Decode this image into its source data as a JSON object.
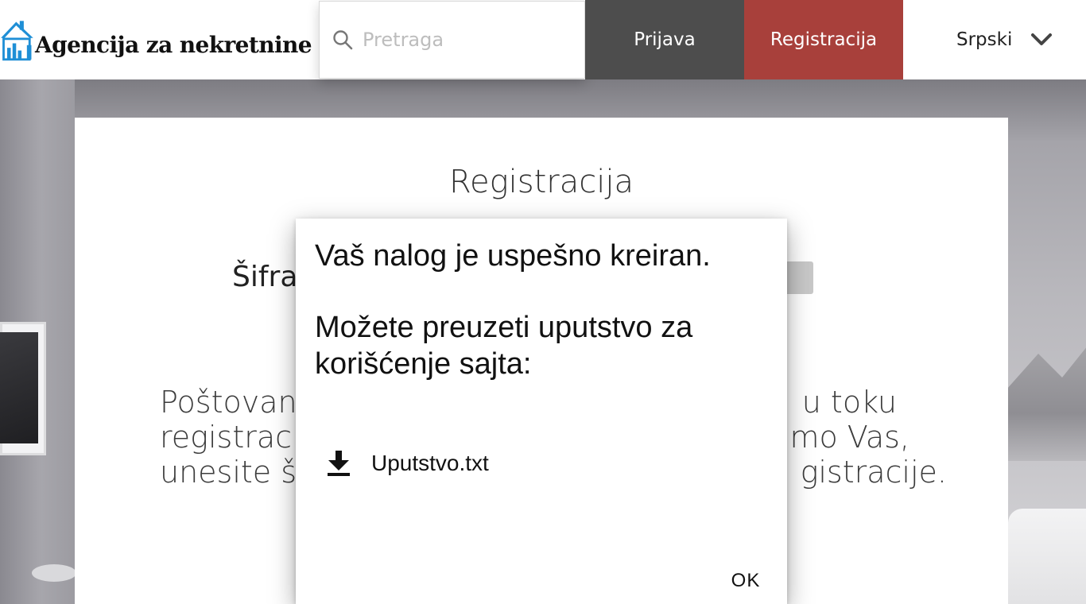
{
  "header": {
    "logo_text": "Agencija za nekretnine",
    "search_placeholder": "Pretraga",
    "login_label": "Prijava",
    "register_label": "Registracija",
    "language": "Srpski"
  },
  "card": {
    "title": "Registracija",
    "code_label": "Šifra",
    "instructions": "Poštovani, u toku registracije... molimo Vas, unesite šifru ... registracije.",
    "instructions_visible_left": [
      "Poštovan",
      "registrac",
      "unesite š"
    ],
    "instructions_visible_right": [
      "u toku",
      "mo Vas,",
      "gistracije."
    ]
  },
  "modal": {
    "message_line1": "Vaš nalog je uspešno kreiran.",
    "message_line2": "Možete preuzeti uputstvo za korišćenje sajta:",
    "download_filename": "Uputstvo.txt",
    "ok_label": "OK"
  },
  "colors": {
    "login_bg": "#4d4d4d",
    "register_bg": "#a8403b",
    "logo_blue": "#1f8fd6"
  }
}
